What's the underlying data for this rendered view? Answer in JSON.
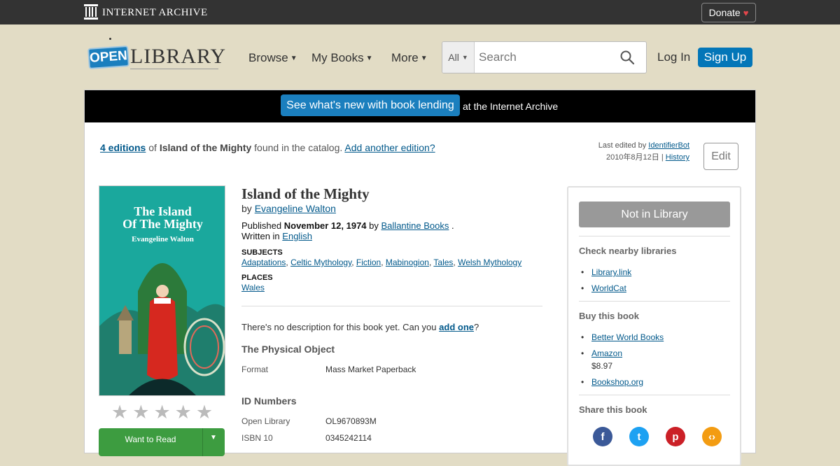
{
  "ia_bar": {
    "logo_text": "INTERNET ARCHIVE",
    "donate_label": "Donate",
    "donate_icon": "heart-icon"
  },
  "header": {
    "logo_open": "OPEN",
    "logo_library": "LIBRARY",
    "nav": [
      {
        "label": "Browse"
      },
      {
        "label": "My Books"
      },
      {
        "label": "More"
      }
    ],
    "search": {
      "scope": "All",
      "placeholder": "Search"
    },
    "login_label": "Log In",
    "signup_label": "Sign Up"
  },
  "banner": {
    "button_label": "See what's new with book lending",
    "text": "at the Internet Archive"
  },
  "editions": {
    "count_link": "4 editions",
    "of_text": "of",
    "title": "Island of the Mighty",
    "found_text": "found in the catalog.",
    "add_link": "Add another edition?"
  },
  "edit_info": {
    "last_edited_by": "Last edited by",
    "editor": "IdentifierBot",
    "date": "2010年8月12日",
    "separator": "|",
    "history_link": "History",
    "edit_button": "Edit"
  },
  "book": {
    "title": "Island of the Mighty",
    "by": "by",
    "author": "Evangeline Walton",
    "published_label": "Published",
    "published_date": "November 12, 1974",
    "publisher_by": "by",
    "publisher": "Ballantine Books",
    "publisher_end": ".",
    "written_in": "Written in",
    "language": "English",
    "subjects_head": "SUBJECTS",
    "subjects": [
      "Adaptations",
      "Celtic Mythology",
      "Fiction",
      "Mabinogion",
      "Tales",
      "Welsh Mythology"
    ],
    "places_head": "PLACES",
    "places": [
      "Wales"
    ],
    "description_text": "There's no description for this book yet. Can you",
    "description_link": "add one",
    "description_end": "?",
    "physical_head": "The Physical Object",
    "format_label": "Format",
    "format_value": "Mass Market Paperback",
    "id_head": "ID Numbers",
    "ids": [
      {
        "label": "Open Library",
        "value": "OL9670893M"
      },
      {
        "label": "ISBN 10",
        "value": "0345242114"
      }
    ],
    "rating_stars": 5,
    "rating_value": 0,
    "want_label": "Want to Read"
  },
  "cover": {
    "line1": "The Island",
    "line2": "Of The Mighty",
    "author": "Evangeline Walton",
    "colors": {
      "bg": "#1aa89d",
      "title": "#ffffff",
      "figure": "#d6281f",
      "hill": "#2c7a3a"
    }
  },
  "sidebar": {
    "status_button": "Not in Library",
    "nearby_head": "Check nearby libraries",
    "nearby": [
      "Library.link",
      "WorldCat"
    ],
    "buy_head": "Buy this book",
    "buy": [
      {
        "name": "Better World Books",
        "price": ""
      },
      {
        "name": "Amazon",
        "price": "$8.97"
      },
      {
        "name": "Bookshop.org",
        "price": ""
      }
    ],
    "share_head": "Share this book",
    "share_icons": [
      {
        "name": "facebook-icon",
        "glyph": "f",
        "color": "#3b5998"
      },
      {
        "name": "twitter-icon",
        "glyph": "t",
        "color": "#1da1f2"
      },
      {
        "name": "pinterest-icon",
        "glyph": "p",
        "color": "#cb2027"
      },
      {
        "name": "embed-icon",
        "glyph": "‹›",
        "color": "#f39c12"
      }
    ]
  }
}
